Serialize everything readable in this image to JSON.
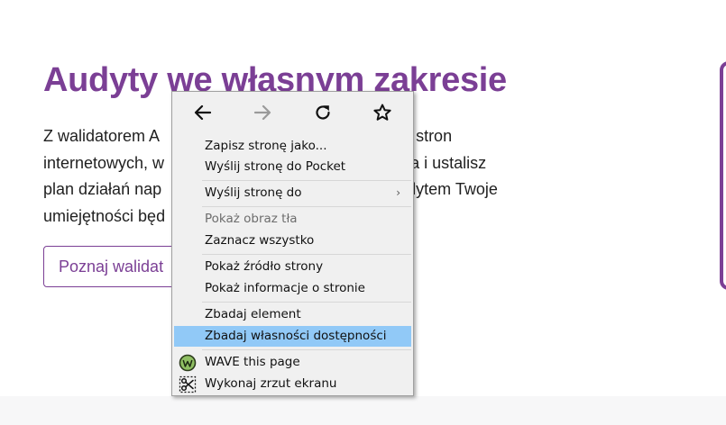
{
  "page": {
    "heading": "Audyty we własnym zakresie",
    "paragraph_lines": [
      "Z walidatorem A",
      "ść stron",
      "internetowych, w",
      "ania i ustalisz",
      "plan działań nap",
      "udytem Twoje",
      "umiejętności będ"
    ],
    "cta_label": "Poznaj walidat"
  },
  "context_menu": {
    "nav": {
      "back_icon": "arrow-left-icon",
      "forward_icon": "arrow-right-icon",
      "reload_icon": "reload-icon",
      "bookmark_icon": "star-icon"
    },
    "items": [
      {
        "label": "Zapisz stronę jako...",
        "disabled": false
      },
      {
        "label": "Wyślij stronę do Pocket",
        "disabled": false
      },
      {
        "label": "Wyślij stronę do",
        "disabled": false,
        "submenu": true
      },
      {
        "label": "Pokaż obraz tła",
        "disabled": true
      },
      {
        "label": "Zaznacz wszystko",
        "disabled": false
      },
      {
        "label": "Pokaż źródło strony",
        "disabled": false
      },
      {
        "label": "Pokaż informacje o stronie",
        "disabled": false
      },
      {
        "label": "Zbadaj element",
        "disabled": false
      },
      {
        "label": "Zbadaj własności dostępności",
        "disabled": false,
        "highlighted": true
      },
      {
        "label": "WAVE this page",
        "disabled": false,
        "icon": "wave-icon"
      },
      {
        "label": "Wykonaj zrzut ekranu",
        "disabled": false,
        "icon": "scissors-icon"
      }
    ],
    "submenu_glyph": "›"
  },
  "colors": {
    "brand_purple": "#7b3f95",
    "menu_bg": "#f0f0f0",
    "menu_highlight": "#91c9f7",
    "text": "#1f1f1f"
  }
}
